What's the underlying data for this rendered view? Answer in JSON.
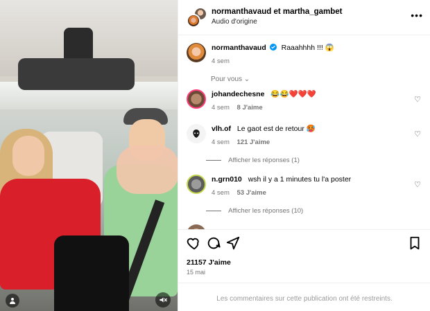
{
  "post": {
    "header": {
      "title": "normanthavaud et martha_gambet",
      "subtitle": "Audio d'origine",
      "more_label": "•••"
    },
    "caption": {
      "username": "normanthavaud",
      "verified": true,
      "text": "Raaahhhh !!! 😱",
      "time": "4 sem"
    },
    "sort_label": "Pour vous ⌄",
    "comments": [
      {
        "username": "johandechesne",
        "text": "😂😂❤️❤️❤️",
        "time": "4 sem",
        "likes": "8 J'aime"
      },
      {
        "username": "vlh.of",
        "text": "Le gaot est de retour 🥵",
        "time": "4 sem",
        "likes": "121 J'aime",
        "replies_label": "Afficher les réponses (1)"
      },
      {
        "username": "n.grn010",
        "text": "wsh il y a 1 minutes tu l'a poster",
        "time": "4 sem",
        "likes": "53 J'aime",
        "replies_label": "Afficher les réponses (10)"
      }
    ],
    "stats": {
      "likes": "21157 J'aime",
      "date": "15 mai"
    },
    "footer": {
      "restricted_text": "Les commentaires sur cette publication ont été restreints."
    },
    "icons": {
      "like": "heart-icon",
      "comment": "comment-icon",
      "share": "send-icon",
      "save": "bookmark-icon",
      "audio": "mute-icon",
      "user": "user-icon"
    },
    "colors": {
      "verified": "#0095f6",
      "muted": "#737373",
      "divider": "#efefef"
    }
  }
}
